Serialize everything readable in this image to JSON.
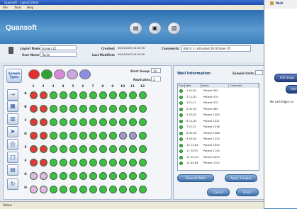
{
  "window": {
    "title": "Quansoft - Layout Editor"
  },
  "menu": [
    "File",
    "Tools",
    "Help"
  ],
  "logo": "Quansoft",
  "header_buttons": [
    {
      "icon": "book-icon",
      "glyph": "▤"
    },
    {
      "icon": "save-icon",
      "glyph": "▣"
    },
    {
      "icon": "folder-icon",
      "glyph": "▧"
    }
  ],
  "info": {
    "layout_name_label": "Layout Name:",
    "layout_name_value": "Screen 12",
    "user_name_label": "User Name:",
    "user_name_value": "Taylor",
    "created_label": "Created:",
    "created_value": "06/10/2003 14:02:56",
    "modified_label": "Last Modified:",
    "modified_value": "06/10/2003 14:02:56",
    "comments_label": "Comments:",
    "comments_value": "Batch 3 cultivated 28 October 05"
  },
  "left": {
    "sample_types_label": "Sample Types",
    "chips": [
      {
        "color": "#e23030"
      },
      {
        "color": "#2fa52f"
      },
      {
        "color": "#d88ad6"
      },
      {
        "color": "#c9a6e0"
      },
      {
        "color": "#8e8ee0"
      }
    ],
    "start_group_label": "Start Group:",
    "start_group_value": "10",
    "replicates_label": "Replicates:",
    "replicates_value": "2",
    "columns": [
      "1",
      "2",
      "3",
      "4",
      "5",
      "6",
      "7",
      "8",
      "9",
      "10",
      "11",
      "12"
    ],
    "rows": [
      "A",
      "B",
      "C",
      "D",
      "E",
      "F",
      "G",
      "H"
    ],
    "well_colors": {
      "red": "#e23a3a",
      "green": "#3fbe45",
      "purple": "#a693d6",
      "pink": "#e7b4e6",
      "white": "#f4f4f4"
    },
    "tools": [
      "pointer-icon",
      "grid-icon",
      "layout-icon",
      "arrow-icon",
      "printer-icon",
      "page-icon",
      "document-icon",
      "cycle-icon"
    ]
  },
  "right": {
    "title": "Well Information",
    "sample_units_label": "Sample Units:",
    "sample_units_value": "",
    "table_headers": [
      "Group",
      "Well",
      "Name",
      "Comment"
    ],
    "rows": [
      {
        "pos": "5 A1,B1",
        "name": "Patient 005"
      },
      {
        "pos": "2 C1,D1",
        "name": "Patient 070"
      },
      {
        "pos": "3 E1,F1",
        "name": "Patient 075"
      },
      {
        "pos": "4 G1,H1",
        "name": "Patient 080"
      },
      {
        "pos": "5 A2,B2",
        "name": "Patient 1004"
      },
      {
        "pos": "6 C2,D2",
        "name": "Patient 1021"
      },
      {
        "pos": "7 E2,F2",
        "name": "Patient 1036"
      },
      {
        "pos": "8 G2,H2",
        "name": "Patient 1086"
      },
      {
        "pos": "9 A3,B3",
        "name": "Patient 1420"
      },
      {
        "pos": "10 C3,D3",
        "name": "Patient 1653"
      },
      {
        "pos": "11 E3,F3",
        "name": "Patient 1753"
      },
      {
        "pos": "12 G3,H3",
        "name": "Patient 2053"
      },
      {
        "pos": "13 A4,B4",
        "name": "Patient 2102"
      }
    ],
    "buttons": [
      "Show all Wells",
      "Apply Samples",
      "Cancel",
      "Finish"
    ]
  },
  "status": "Status",
  "side_window": {
    "tree_label": "Mult",
    "add_stage_label": "Add Stage",
    "second_button": "Add",
    "empty_text": "No cartridges ca"
  }
}
